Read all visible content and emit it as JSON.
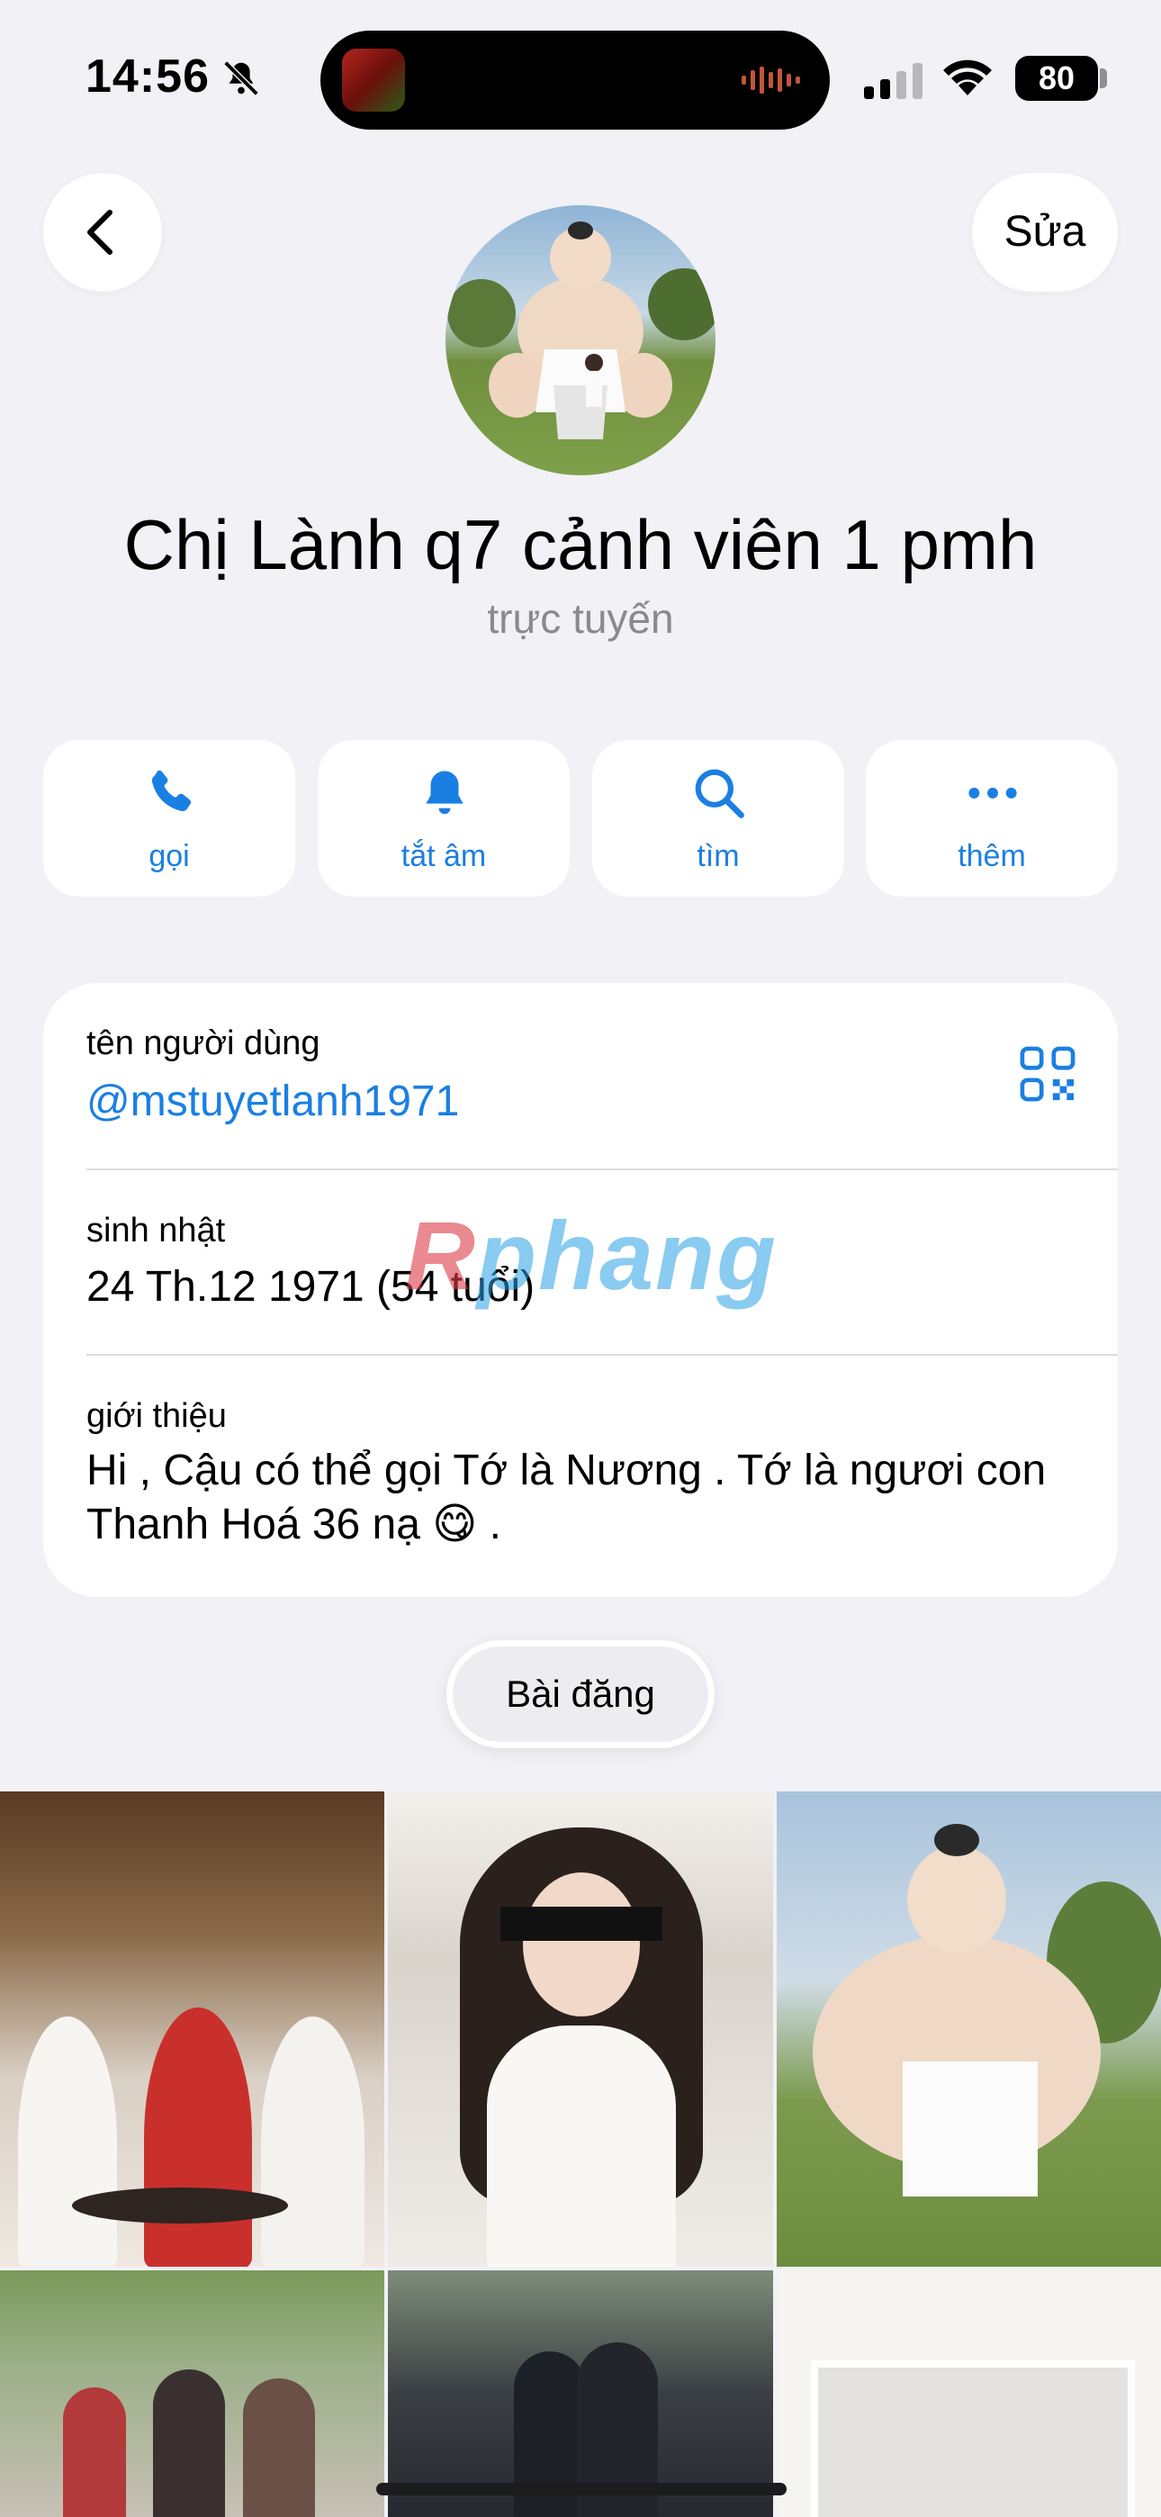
{
  "status_bar": {
    "time": "14:56",
    "battery": "80",
    "icons": [
      "bell-slash-icon",
      "signal-icon",
      "wifi-icon",
      "battery-icon"
    ]
  },
  "header": {
    "edit_label": "Sửa",
    "name": "Chị Lành q7 cảnh viên 1 pmh",
    "status": "trực tuyến"
  },
  "actions": [
    {
      "label": "gọi",
      "icon": "phone-icon"
    },
    {
      "label": "tắt âm",
      "icon": "bell-icon"
    },
    {
      "label": "tìm",
      "icon": "search-icon"
    },
    {
      "label": "thêm",
      "icon": "more-icon"
    }
  ],
  "info": {
    "username_label": "tên người dùng",
    "username": "@mstuyetlanh1971",
    "birthday_label": "sinh nhật",
    "birthday": "24 Th.12 1971 (54 tuổi)",
    "bio_label": "giới thiệu",
    "bio": "Hi , Cậu có thể gọi Tớ là Nương . Tớ là ngươi con Thanh Hoá 36 nạ 😋 ."
  },
  "watermark": {
    "first": "R",
    "rest": "phang"
  },
  "tabs": {
    "posts_label": "Bài đăng"
  },
  "colors": {
    "accent": "#1a7fe3",
    "background": "#f1f1f6",
    "card": "#ffffff"
  }
}
